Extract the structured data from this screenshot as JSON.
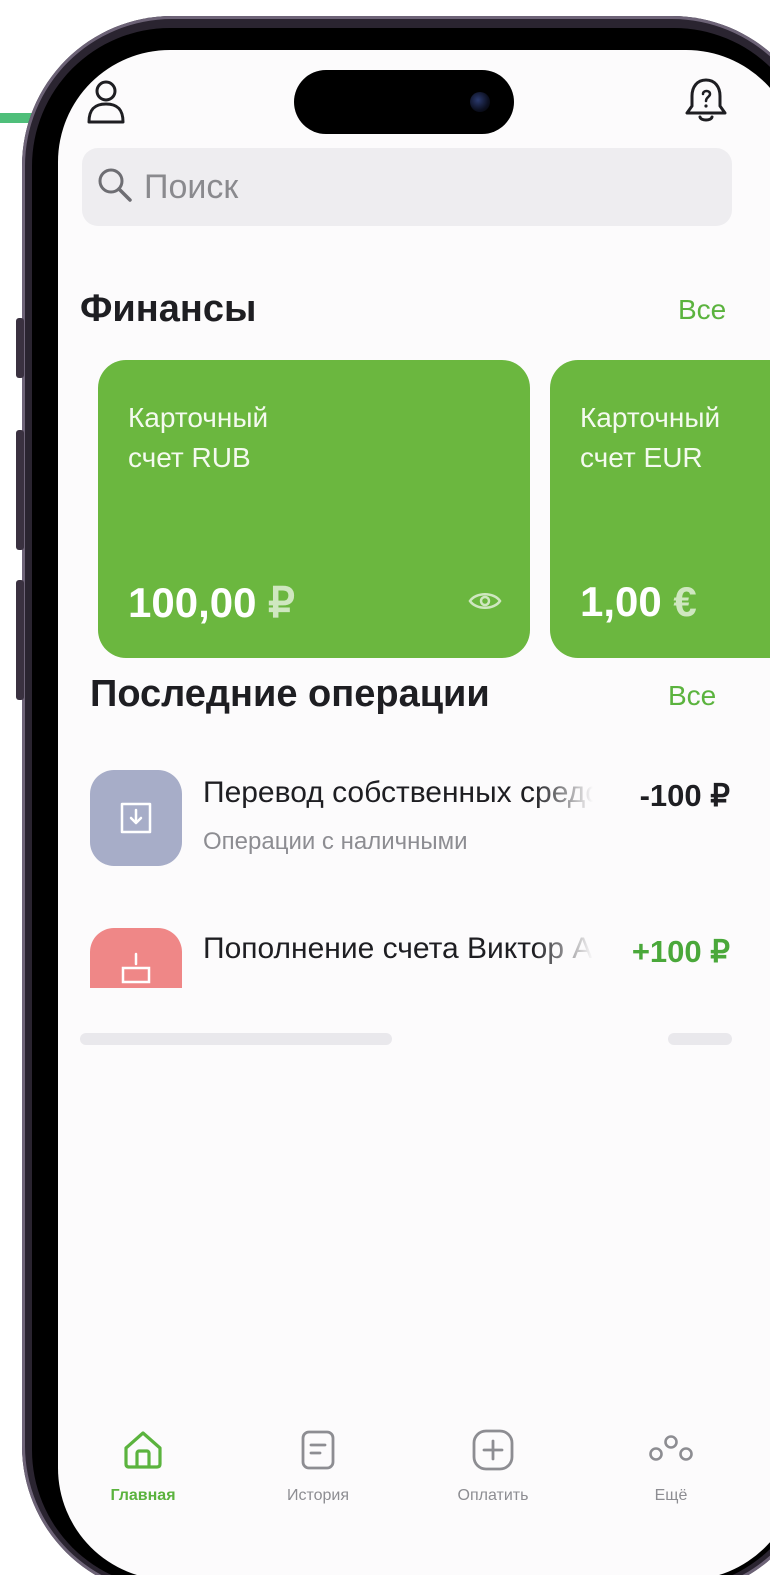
{
  "header": {
    "profile_icon": "person-icon",
    "notifications_icon": "bell-icon"
  },
  "search": {
    "placeholder": "Поиск",
    "icon": "search-icon"
  },
  "finances": {
    "title": "Финансы",
    "see_all": "Все",
    "cards": [
      {
        "title": "Карточный\nсчет RUB",
        "amount": "100,00",
        "currency": "₽",
        "visibility_icon": "eye-icon",
        "color": "#6bb73f"
      },
      {
        "title": "Карточный\nсчет EUR",
        "amount": "1,00",
        "currency": "€",
        "color": "#6bb73f"
      }
    ]
  },
  "operations": {
    "title": "Последние операции",
    "see_all": "Все",
    "items": [
      {
        "title": "Перевод собственных средств",
        "subtitle": "Операции с наличными",
        "amount": "-100 ₽",
        "amount_color": "#1e1e22",
        "icon": "cash-withdraw-icon",
        "icon_color": "#a7adc8"
      },
      {
        "title": "Пополнение счета Виктор А.",
        "amount": "+100 ₽",
        "amount_color": "#4aa83a",
        "icon": "deposit-icon",
        "icon_color": "#ef8787"
      }
    ]
  },
  "tabbar": {
    "items": [
      {
        "label": "Главная",
        "icon": "home-icon",
        "active": true
      },
      {
        "label": "История",
        "icon": "history-icon",
        "active": false
      },
      {
        "label": "Оплатить",
        "icon": "pay-plus-icon",
        "active": false
      },
      {
        "label": "Ещё",
        "icon": "more-icon",
        "active": false
      }
    ]
  },
  "colors": {
    "accent": "#5bb33e",
    "card": "#6bb73f",
    "positive_amount": "#4aa83a"
  }
}
